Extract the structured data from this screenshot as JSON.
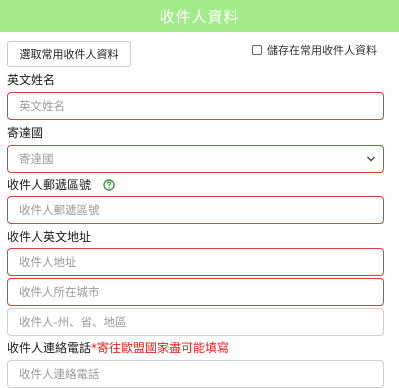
{
  "header": {
    "title": "收件人資料"
  },
  "actions": {
    "select_frequent": "選取常用收件人資料",
    "save_frequent": "儲存在常用收件人資料"
  },
  "fields": {
    "english_name": {
      "label": "英文姓名",
      "placeholder": "英文姓名"
    },
    "country": {
      "label": "寄達國",
      "value": "寄達國"
    },
    "postal_code": {
      "label": "收件人郵遞區號",
      "placeholder": "收件人郵遞區號"
    },
    "english_address": {
      "label": "收件人英文地址",
      "address_placeholder": "收件人地址",
      "city_placeholder": "收件人所在城市",
      "state_placeholder": "收件人-州、省、地區"
    },
    "phone": {
      "label": "收件人連絡電話",
      "note": "*寄往歐盟國家盡可能填寫",
      "placeholder": "收件人連絡電話"
    }
  },
  "colors": {
    "header_bg": "#a3ea8a",
    "error_border": "#e23b3b",
    "note_red": "#e0241b",
    "help_icon_green": "#3a9a3a"
  },
  "icons": {
    "help": "question-circle-icon",
    "select_arrow": "chevron-down-icon"
  }
}
